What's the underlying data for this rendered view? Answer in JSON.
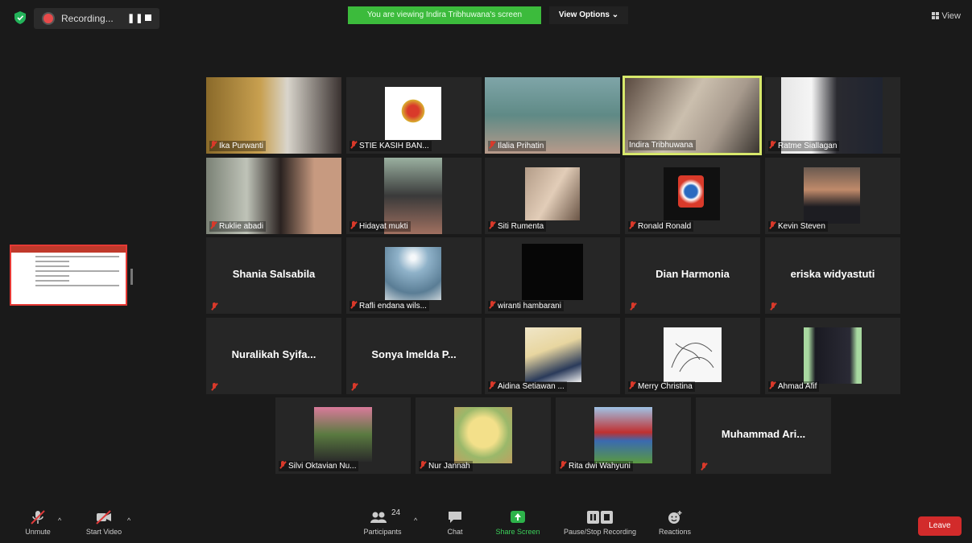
{
  "topbar": {
    "recording_label": "Recording...",
    "pause_glyph": "❚❚",
    "viewing_banner": "You are viewing Indira Tribhuwana's screen",
    "view_options": "View Options ⌄",
    "view_label": "View"
  },
  "participants": [
    {
      "name": "Ika Purwanti",
      "muted": true,
      "video": "photo"
    },
    {
      "name": "STIE KASIH BAN...",
      "muted": true,
      "video": "logo"
    },
    {
      "name": "Ilalia Prihatin",
      "muted": true,
      "video": "photo"
    },
    {
      "name": "Indira Tribhuwana",
      "muted": false,
      "video": "photo",
      "active": true
    },
    {
      "name": "Ratme Siallagan",
      "muted": true,
      "video": "photo"
    },
    {
      "name": "Ruklie abadi",
      "muted": true,
      "video": "photo"
    },
    {
      "name": "Hidayat mukti",
      "muted": true,
      "video": "photo"
    },
    {
      "name": "Siti Rumenta",
      "muted": true,
      "video": "photo"
    },
    {
      "name": "Ronald Ronald",
      "muted": true,
      "video": "photo"
    },
    {
      "name": "Kevin Steven",
      "muted": true,
      "video": "photo"
    },
    {
      "name": "Shania Salsabila",
      "muted": true,
      "video": "none"
    },
    {
      "name": "Rafli endana wils...",
      "muted": true,
      "video": "photo"
    },
    {
      "name": "wiranti hambarani",
      "muted": true,
      "video": "photo"
    },
    {
      "name": "Dian Harmonia",
      "muted": true,
      "video": "none"
    },
    {
      "name": "eriska widyastuti",
      "muted": true,
      "video": "none"
    },
    {
      "name": "Nuralikah Syifa...",
      "muted": true,
      "video": "none"
    },
    {
      "name": "Sonya Imelda P...",
      "muted": true,
      "video": "none"
    },
    {
      "name": "Aidina Setiawan ...",
      "muted": true,
      "video": "photo"
    },
    {
      "name": "Merry Christina",
      "muted": true,
      "video": "photo"
    },
    {
      "name": "Ahmad Afif",
      "muted": true,
      "video": "photo"
    },
    {
      "name": "Silvi Oktavian Nu...",
      "muted": true,
      "video": "photo"
    },
    {
      "name": "Nur Jannah",
      "muted": true,
      "video": "photo"
    },
    {
      "name": "Rita dwi Wahyuni",
      "muted": true,
      "video": "photo"
    },
    {
      "name": "Muhammad Ari...",
      "muted": true,
      "video": "none"
    }
  ],
  "toolbar": {
    "unmute": "Unmute",
    "start_video": "Start Video",
    "participants": "Participants",
    "participant_count": "24",
    "chat": "Chat",
    "share_screen": "Share Screen",
    "pause_recording": "Pause/Stop Recording",
    "reactions": "Reactions",
    "leave": "Leave"
  },
  "colors": {
    "background": "#1a1a1a",
    "tile": "#262626",
    "active_border": "#d7e86b",
    "banner_green": "#3cbb3c",
    "share_green": "#2db34a",
    "leave_red": "#d22b2b",
    "muted_red": "#d9392a"
  }
}
